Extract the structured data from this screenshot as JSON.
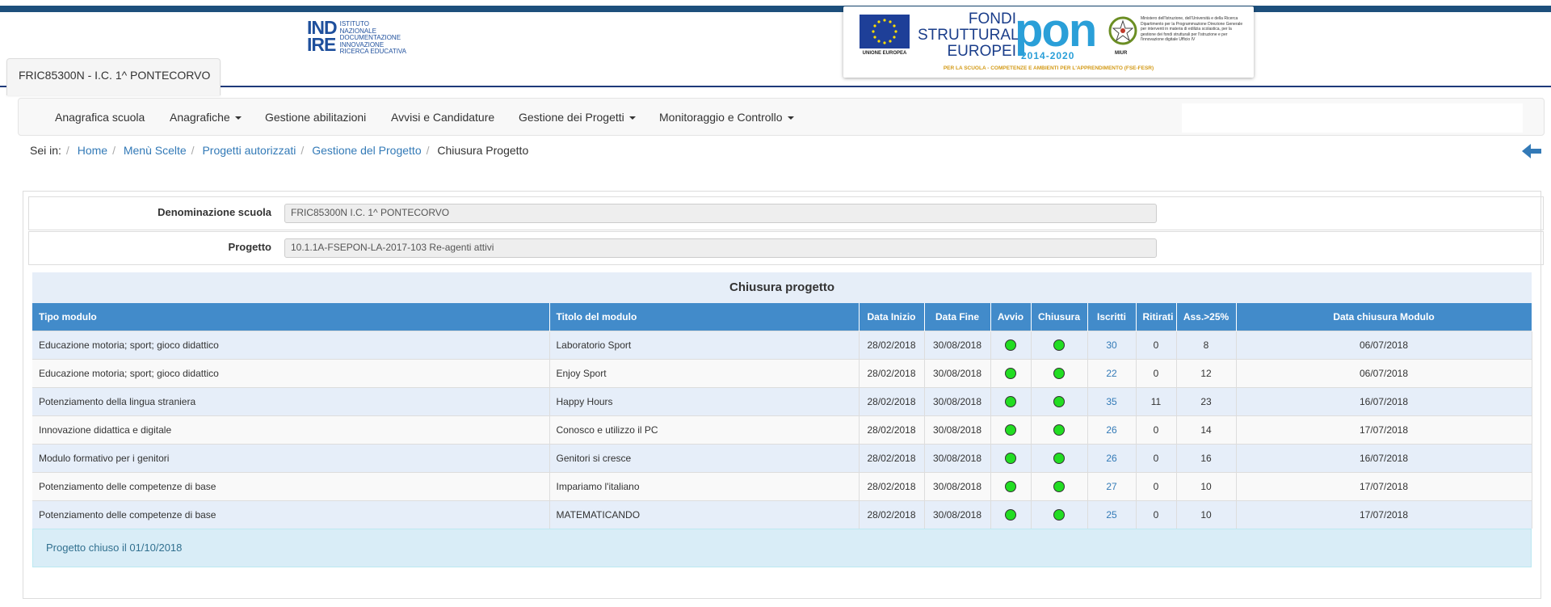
{
  "header": {
    "indire_logo_text": "IND IRE",
    "indire_big_1": "IND",
    "indire_big_2": "IRE",
    "indire_lines": [
      "ISTITUTO",
      "NAZIONALE",
      "DOCUMENTAZIONE",
      "INNOVAZIONE",
      "RICERCA EDUCATIVA"
    ],
    "pon": {
      "eu_label": "UNIONE EUROPEA",
      "fondi_lines": [
        "FONDI",
        "STRUTTURALI",
        "EUROPEI"
      ],
      "pon_word": "pon",
      "years": "2014-2020",
      "miur_label": "MIUR",
      "miur_text": "Ministero dell'Istruzione, dell'Università e della Ricerca Dipartimento per la Programmazione Direzione Generale per interventi in materia di edilizia scolastica, per la gestione dei fondi strutturali per l'istruzione e per l'innovazione digitale Ufficio IV",
      "tagline": "PER LA SCUOLA - COMPETENZE E AMBIENTI PER L'APPRENDIMENTO (FSE-FESR)"
    },
    "school_tab": "FRIC85300N - I.C. 1^ PONTECORVO"
  },
  "nav": {
    "items": [
      {
        "label": "Anagrafica scuola",
        "dropdown": false
      },
      {
        "label": "Anagrafiche",
        "dropdown": true
      },
      {
        "label": "Gestione abilitazioni",
        "dropdown": false
      },
      {
        "label": "Avvisi e Candidature",
        "dropdown": false
      },
      {
        "label": "Gestione dei Progetti",
        "dropdown": true
      },
      {
        "label": "Monitoraggio e Controllo",
        "dropdown": true
      }
    ]
  },
  "breadcrumb": {
    "prefix": "Sei in:",
    "links": [
      "Home",
      "Menù Scelte",
      "Progetti autorizzati",
      "Gestione del Progetto"
    ],
    "current": "Chiusura Progetto"
  },
  "form": {
    "school_label": "Denominazione scuola",
    "school_value": "FRIC85300N I.C. 1^ PONTECORVO",
    "project_label": "Progetto",
    "project_value": "10.1.1A-FSEPON-LA-2017-103 Re-agenti attivi"
  },
  "table": {
    "title": "Chiusura progetto",
    "headers": [
      "Tipo modulo",
      "Titolo del modulo",
      "Data Inizio",
      "Data Fine",
      "Avvio",
      "Chiusura",
      "Iscritti",
      "Ritirati",
      "Ass.>25%",
      "Data chiusura Modulo"
    ],
    "rows": [
      {
        "tipo": "Educazione motoria; sport; gioco didattico",
        "titolo": "Laboratorio Sport",
        "inizio": "28/02/2018",
        "fine": "30/08/2018",
        "avvio": "green",
        "chiusura": "green",
        "iscritti": "30",
        "ritirati": "0",
        "ass": "8",
        "data_chiusura": "06/07/2018"
      },
      {
        "tipo": "Educazione motoria; sport; gioco didattico",
        "titolo": "Enjoy Sport",
        "inizio": "28/02/2018",
        "fine": "30/08/2018",
        "avvio": "green",
        "chiusura": "green",
        "iscritti": "22",
        "ritirati": "0",
        "ass": "12",
        "data_chiusura": "06/07/2018"
      },
      {
        "tipo": "Potenziamento della lingua straniera",
        "titolo": "Happy Hours",
        "inizio": "28/02/2018",
        "fine": "30/08/2018",
        "avvio": "green",
        "chiusura": "green",
        "iscritti": "35",
        "ritirati": "11",
        "ass": "23",
        "data_chiusura": "16/07/2018"
      },
      {
        "tipo": "Innovazione didattica e digitale",
        "titolo": "Conosco e utilizzo il PC",
        "inizio": "28/02/2018",
        "fine": "30/08/2018",
        "avvio": "green",
        "chiusura": "green",
        "iscritti": "26",
        "ritirati": "0",
        "ass": "14",
        "data_chiusura": "17/07/2018"
      },
      {
        "tipo": "Modulo formativo per i genitori",
        "titolo": "Genitori si cresce",
        "inizio": "28/02/2018",
        "fine": "30/08/2018",
        "avvio": "green",
        "chiusura": "green",
        "iscritti": "26",
        "ritirati": "0",
        "ass": "16",
        "data_chiusura": "16/07/2018"
      },
      {
        "tipo": "Potenziamento delle competenze di base",
        "titolo": "Impariamo l'italiano",
        "inizio": "28/02/2018",
        "fine": "30/08/2018",
        "avvio": "green",
        "chiusura": "green",
        "iscritti": "27",
        "ritirati": "0",
        "ass": "10",
        "data_chiusura": "17/07/2018"
      },
      {
        "tipo": "Potenziamento delle competenze di base",
        "titolo": "MATEMATICANDO",
        "inizio": "28/02/2018",
        "fine": "30/08/2018",
        "avvio": "green",
        "chiusura": "green",
        "iscritti": "25",
        "ritirati": "0",
        "ass": "10",
        "data_chiusura": "17/07/2018"
      }
    ],
    "footer": "Progetto chiuso il 01/10/2018"
  },
  "colors": {
    "header_bar": "#1d4f7c",
    "table_header": "#428bca",
    "link": "#337ab7",
    "status_green": "#22dd22"
  },
  "icons": {
    "back": "back-arrow-icon",
    "status": "green-dot-icon",
    "dropdown": "caret-down-icon"
  }
}
